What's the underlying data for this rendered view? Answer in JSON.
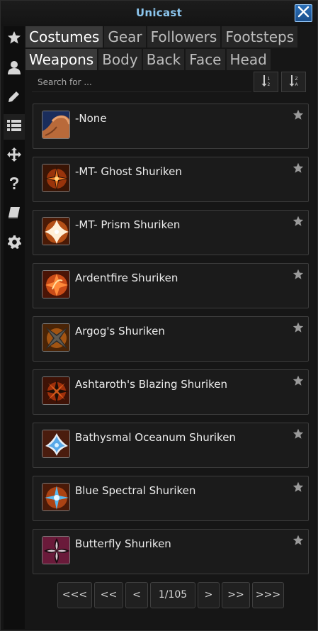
{
  "window": {
    "title": "Unicast",
    "close_icon": "close-icon"
  },
  "sidebar": {
    "items": [
      {
        "name": "favorites",
        "icon": "star-icon",
        "active": false
      },
      {
        "name": "profile",
        "icon": "user-icon",
        "active": false
      },
      {
        "name": "edit",
        "icon": "pencil-icon",
        "active": false
      },
      {
        "name": "list",
        "icon": "list-icon",
        "active": true
      },
      {
        "name": "move",
        "icon": "move-icon",
        "active": false
      },
      {
        "name": "help",
        "icon": "question-icon",
        "active": false
      },
      {
        "name": "book",
        "icon": "book-icon",
        "active": false
      },
      {
        "name": "settings",
        "icon": "gear-icon",
        "active": false
      }
    ]
  },
  "tabs_top": [
    {
      "label": "Costumes",
      "active": true
    },
    {
      "label": "Gear",
      "active": false
    },
    {
      "label": "Followers",
      "active": false
    },
    {
      "label": "Footsteps",
      "active": false
    }
  ],
  "tabs_sub": [
    {
      "label": "Weapons",
      "active": true
    },
    {
      "label": "Body",
      "active": false
    },
    {
      "label": "Back",
      "active": false
    },
    {
      "label": "Face",
      "active": false
    },
    {
      "label": "Head",
      "active": false
    }
  ],
  "search": {
    "placeholder": "Search for ..."
  },
  "sort": {
    "ascending_icon": "sort-ascending-icon",
    "descending_icon": "sort-descending-icon"
  },
  "items": [
    {
      "name": "-None",
      "icon": "arm-icon"
    },
    {
      "name": "-MT- Ghost Shuriken",
      "icon": "shuriken-ghost-icon"
    },
    {
      "name": "-MT- Prism Shuriken",
      "icon": "shuriken-prism-icon"
    },
    {
      "name": "Ardentfire Shuriken",
      "icon": "shuriken-ardentfire-icon"
    },
    {
      "name": "Argog's Shuriken",
      "icon": "shuriken-argog-icon"
    },
    {
      "name": "Ashtaroth's Blazing Shuriken",
      "icon": "shuriken-blazing-icon"
    },
    {
      "name": "Bathysmal Oceanum Shuriken",
      "icon": "shuriken-oceanum-icon"
    },
    {
      "name": "Blue Spectral Shuriken",
      "icon": "shuriken-spectral-icon"
    },
    {
      "name": "Butterfly Shuriken",
      "icon": "shuriken-butterfly-icon"
    }
  ],
  "pager": {
    "first": "<<<",
    "prev_many": "<<",
    "prev": "<",
    "page": "1/105",
    "next": ">",
    "next_many": ">>",
    "last": ">>>"
  },
  "colors": {
    "title": "#8cc6ee",
    "accent": "#2a6fb8",
    "icon_fire": "#e0561c",
    "icon_blue": "#58a8e8",
    "icon_purple": "#6a1a3a"
  }
}
